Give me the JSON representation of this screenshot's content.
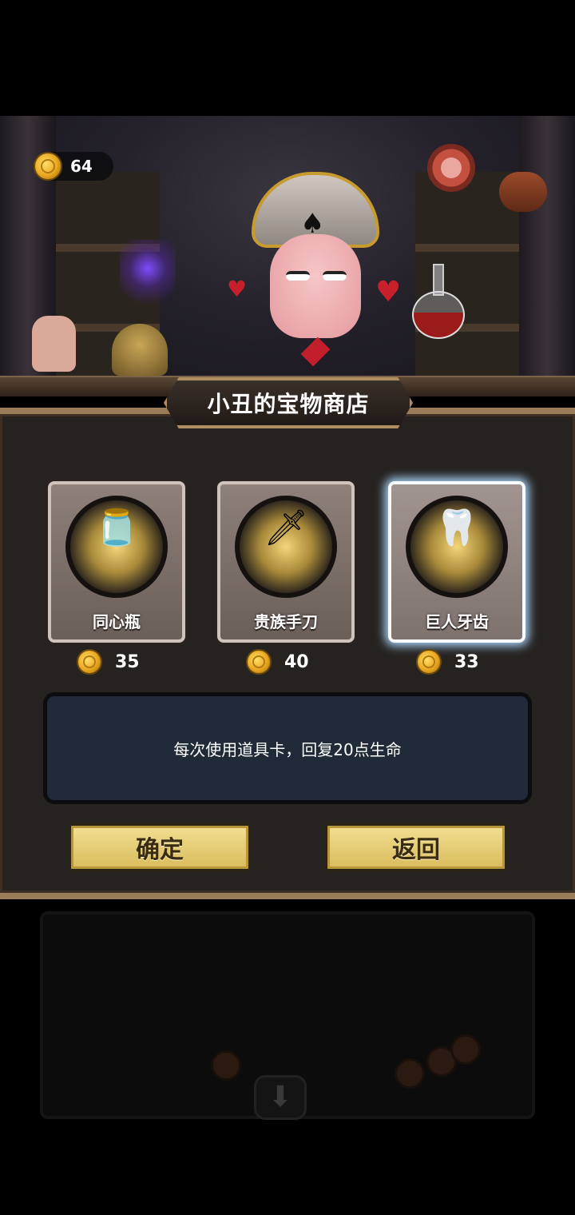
{
  "header": {
    "coins": "64",
    "shop_title": "小丑的宝物商店"
  },
  "items": [
    {
      "name": "同心瓶",
      "price": "35",
      "icon": "heart-jar-icon",
      "selected": false
    },
    {
      "name": "贵族手刀",
      "price": "40",
      "icon": "noble-dagger-icon",
      "selected": false
    },
    {
      "name": "巨人牙齿",
      "price": "33",
      "icon": "giant-tooth-icon",
      "selected": true
    }
  ],
  "description": "每次使用道具卡，回复20点生命",
  "buttons": {
    "confirm": "确定",
    "back": "返回"
  },
  "colors": {
    "button_bg": "#e6cd75",
    "selected_glow": "#a9d8ff",
    "desc_bg": "#202a38"
  }
}
